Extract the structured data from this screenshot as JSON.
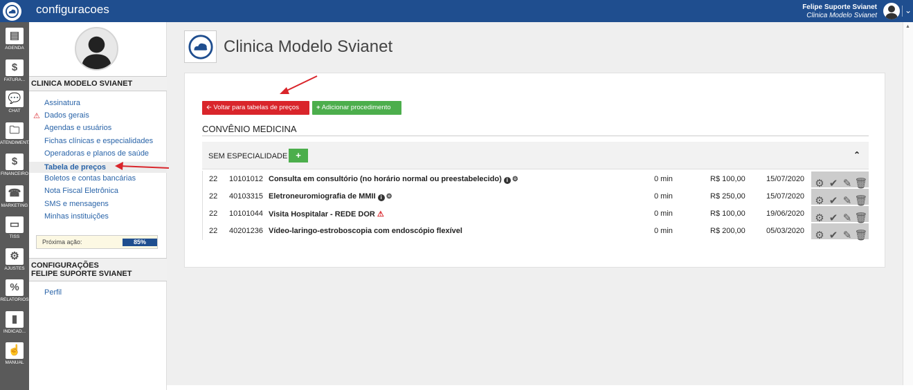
{
  "topbar": {
    "title": "configuracoes",
    "user_name": "Felipe Suporte Svianet",
    "user_clinic": "Clinica Modelo Svianet"
  },
  "iconbar": [
    {
      "label": "AGENDA",
      "icon": "calendar-icon"
    },
    {
      "label": "FATURA...",
      "icon": "invoice-dollar-icon"
    },
    {
      "label": "CHAT",
      "icon": "chat-bubbles-icon"
    },
    {
      "label": "ATENDIMENT...",
      "icon": "folder-check-icon"
    },
    {
      "label": "FINANCEIRO",
      "icon": "dollar-document-icon"
    },
    {
      "label": "MARKETING",
      "icon": "phone-icon"
    },
    {
      "label": "TISS",
      "icon": "card-icon"
    },
    {
      "label": "AJUSTES",
      "icon": "gears-icon"
    },
    {
      "label": "RELATORIOS",
      "icon": "percent-document-icon"
    },
    {
      "label": "INDICAD...",
      "icon": "bar-chart-icon"
    },
    {
      "label": "MANUAL",
      "icon": "touch-manual-icon"
    }
  ],
  "sidebar": {
    "clinic_header": "CLINICA MODELO SVIANET",
    "links": [
      {
        "label": "Assinatura",
        "warning": false,
        "active": false
      },
      {
        "label": "Dados gerais",
        "warning": true,
        "active": false
      },
      {
        "label": "Agendas e usuários",
        "warning": false,
        "active": false
      },
      {
        "label": "Fichas clínicas e especialidades",
        "warning": false,
        "active": false
      },
      {
        "label": "Operadoras e planos de saúde",
        "warning": false,
        "active": false
      },
      {
        "label": "Tabela de preços",
        "warning": false,
        "active": true
      },
      {
        "label": "Boletos e contas bancárias",
        "warning": false,
        "active": false
      },
      {
        "label": "Nota Fiscal Eletrônica",
        "warning": false,
        "active": false
      },
      {
        "label": "SMS e mensagens",
        "warning": false,
        "active": false
      },
      {
        "label": "Minhas instituições",
        "warning": false,
        "active": false
      }
    ],
    "next_action_label": "Próxima ação:",
    "next_action_progress": "85%",
    "config_header_line1": "CONFIGURAÇÕES",
    "config_header_line2": "FELIPE SUPORTE SVIANET",
    "profile_link": "Perfil"
  },
  "main": {
    "clinic_title": "Clinica Modelo Svianet",
    "back_button": "Voltar para tabelas de preços",
    "add_button": "Adicionar procedimento",
    "convenio_title": "CONVÊNIO MEDICINA",
    "specialty_label": "SEM ESPECIALIDADE",
    "procedures": [
      {
        "qty": "22",
        "code": "10101012",
        "name": "Consulta em consultório (no horário normal ou preestabelecido)",
        "info": true,
        "cogs": true,
        "warn": false,
        "time": "0 min",
        "price": "R$ 100,00",
        "date": "15/07/2020"
      },
      {
        "qty": "22",
        "code": "40103315",
        "name": "Eletroneuromiografia de MMII",
        "info": true,
        "cogs": true,
        "warn": false,
        "time": "0 min",
        "price": "R$ 250,00",
        "date": "15/07/2020"
      },
      {
        "qty": "22",
        "code": "10101044",
        "name": "Visita Hospitalar - REDE DOR",
        "info": false,
        "cogs": false,
        "warn": true,
        "time": "0 min",
        "price": "R$ 100,00",
        "date": "19/06/2020"
      },
      {
        "qty": "22",
        "code": "40201236",
        "name": "Vídeo-laringo-estroboscopia com endoscópio flexível",
        "info": false,
        "cogs": false,
        "warn": false,
        "time": "0 min",
        "price": "R$ 200,00",
        "date": "05/03/2020"
      }
    ]
  },
  "colors": {
    "brand_blue": "#1f4e8f",
    "danger_red": "#d9252b",
    "success_green": "#4cae4c",
    "link_blue": "#2a64a8"
  }
}
